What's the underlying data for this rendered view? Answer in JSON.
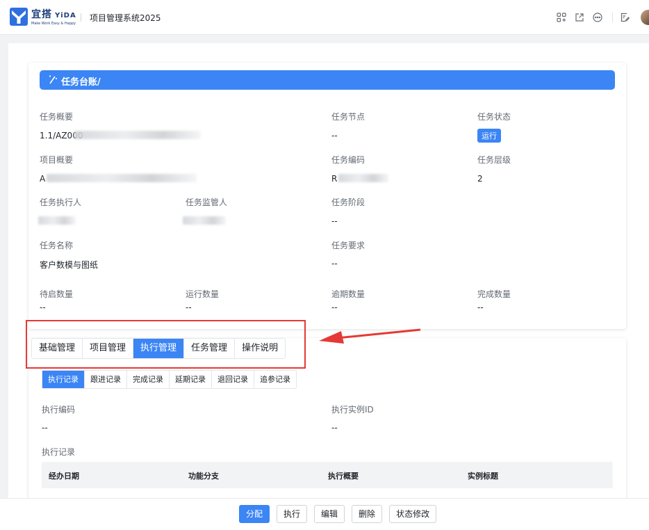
{
  "app": {
    "brand_cn": "宜搭",
    "brand_en": "YiDA",
    "brand_slogan": "Make Work Easy & Happy",
    "title": "项目管理系统2025"
  },
  "topbar_icons": [
    "apps-icon",
    "share-icon",
    "more-icon",
    "edit-icon"
  ],
  "ledger": {
    "title": "任务台账/",
    "fields": {
      "task_summary": {
        "label": "任务概要",
        "value": "1.1/AZ000"
      },
      "task_node": {
        "label": "任务节点",
        "value": "--"
      },
      "task_status": {
        "label": "任务状态",
        "value": "运行"
      },
      "project_summary": {
        "label": "项目概要",
        "value": "A"
      },
      "task_code": {
        "label": "任务编码",
        "value": "R"
      },
      "task_level": {
        "label": "任务层级",
        "value": "2"
      },
      "task_executor": {
        "label": "任务执行人",
        "value": ""
      },
      "task_supervisor": {
        "label": "任务监管人",
        "value": ""
      },
      "task_stage": {
        "label": "任务阶段",
        "value": "--"
      },
      "task_name": {
        "label": "任务名称",
        "value": "客户数模与图纸"
      },
      "task_requirement": {
        "label": "任务要求",
        "value": "--"
      },
      "pending_count": {
        "label": "待启数量",
        "value": "--"
      },
      "running_count": {
        "label": "运行数量",
        "value": "--"
      },
      "overdue_count": {
        "label": "逾期数量",
        "value": "--"
      },
      "completed_count": {
        "label": "完成数量",
        "value": "--"
      }
    }
  },
  "main_tabs": [
    "基础管理",
    "项目管理",
    "执行管理",
    "任务管理",
    "操作说明"
  ],
  "main_tab_active": "执行管理",
  "sub_tabs": [
    "执行记录",
    "跟进记录",
    "完成记录",
    "延期记录",
    "退回记录",
    "追参记录"
  ],
  "sub_tab_active": "执行记录",
  "exec": {
    "code_label": "执行编码",
    "code_value": "--",
    "instance_label": "执行实例ID",
    "instance_value": "--",
    "records_label": "执行记录",
    "columns": [
      "经办日期",
      "功能分支",
      "执行概要",
      "实例标题"
    ]
  },
  "actions": [
    "分配",
    "执行",
    "编辑",
    "删除",
    "状态修改"
  ]
}
